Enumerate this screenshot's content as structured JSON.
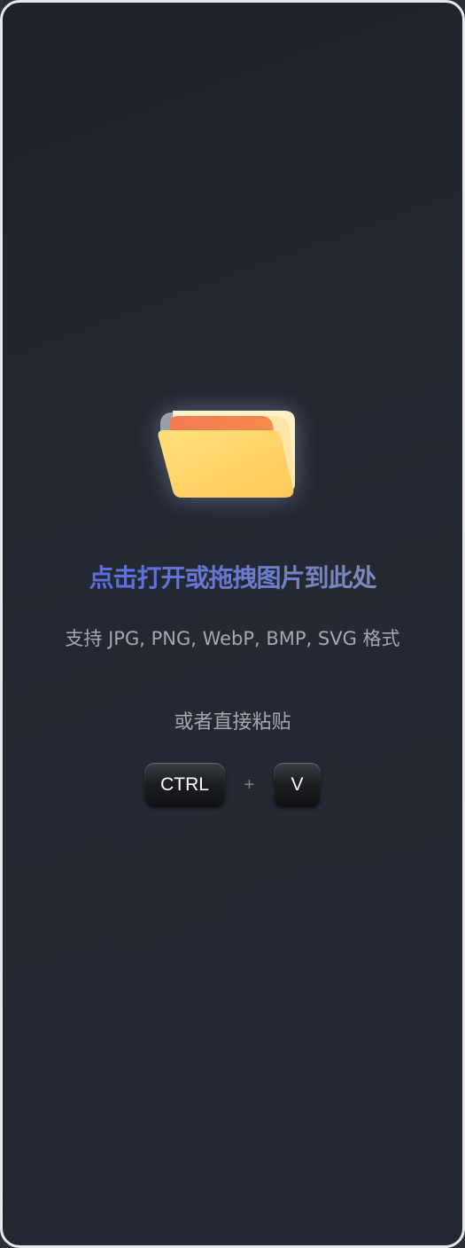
{
  "dropzone": {
    "title": "点击打开或拖拽图片到此处",
    "formats": "支持 JPG, PNG, WebP, BMP, SVG 格式",
    "paste_hint": "或者直接粘贴",
    "shortcut": {
      "key1": "CTRL",
      "plus": "+",
      "key2": "V"
    },
    "icon": "folder-icon"
  },
  "colors": {
    "title_gradient_start": "#4f66e8",
    "title_gradient_end": "#8a93b3",
    "hint_text": "#a4a8b0",
    "folder_front": "#ffd466",
    "folder_tab": "#f07c4a"
  }
}
